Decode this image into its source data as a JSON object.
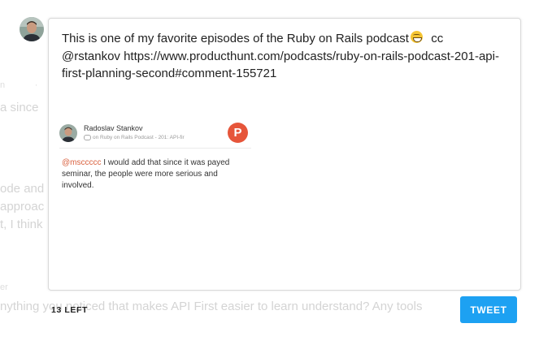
{
  "background_text": {
    "line1": "a since",
    "line2": "ode and",
    "line3": "approac",
    "line4": "t, I think",
    "line5": "nything you noticed that makes API First easier to learn understand? Any tools"
  },
  "composer": {
    "text_part1": "This is one of my favorite episodes of the Ruby on Rails podcast",
    "emoji": "grinning-face-emoji",
    "text_part2": "  cc @rstankov https://www.producthunt.com/podcasts/ruby-on-rails-podcast-201-api-first-planning-second#comment-155721"
  },
  "preview_card": {
    "author": "Radoslav Stankov",
    "context": "on Ruby on Rails Podcast - 201: API-fir",
    "mention": "@msccccc",
    "comment": " I would add that since it was payed seminar, the people were more serious and involved."
  },
  "footer": {
    "chars_left": "13 LEFT",
    "tweet_button": "TWEET"
  },
  "colors": {
    "tweet_button": "#1da1f2",
    "product_hunt": "#e6553a",
    "mention": "#d9603e"
  }
}
